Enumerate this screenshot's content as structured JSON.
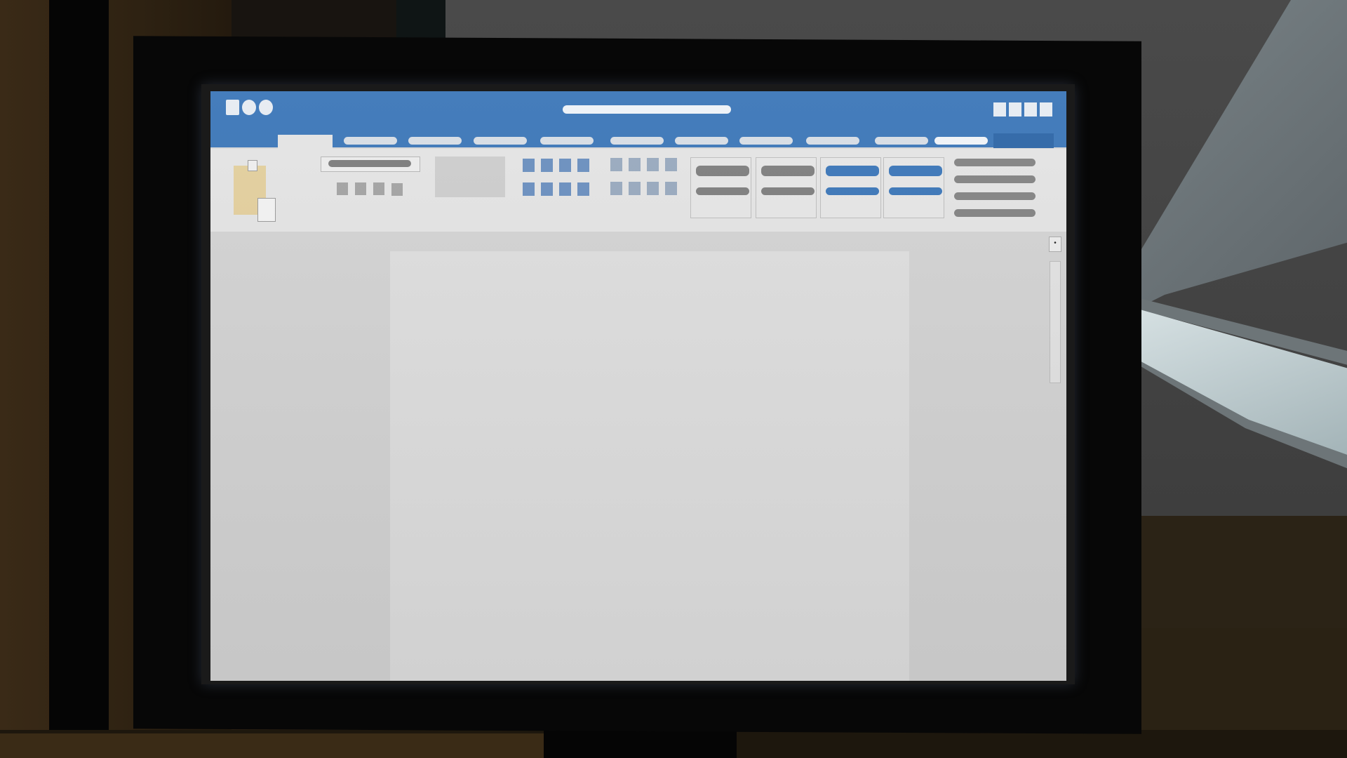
{
  "app": {
    "window_title": "",
    "accent_color": "#3b76b8",
    "share_color": "#2c65a6"
  },
  "titlebar": {
    "left_controls": [
      "app-icon",
      "undo-icon",
      "redo-icon"
    ],
    "right_controls": [
      "account-icon",
      "minimize-icon",
      "maximize-icon",
      "close-icon"
    ]
  },
  "ribbon": {
    "tabs": [
      "",
      "",
      "",
      "",
      "",
      "",
      "",
      "",
      "",
      "",
      ""
    ],
    "active_tab_index": 0,
    "groups": [
      "clipboard",
      "font",
      "paragraph",
      "styles",
      "editing"
    ]
  },
  "scrollbar": {
    "up_glyph": "•"
  }
}
